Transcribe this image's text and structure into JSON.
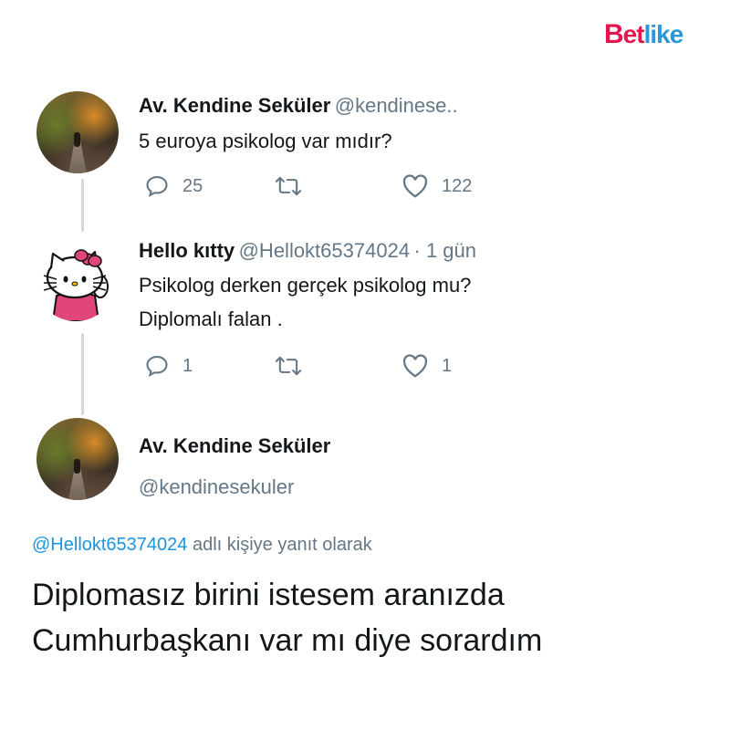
{
  "brand": {
    "logo_text_1": "B",
    "logo_text_2": "et",
    "logo_text_3": "like"
  },
  "tweets": [
    {
      "name": "Av. Kendine Seküler",
      "handle": "@kendinese..",
      "text": "5 euroya psikolog var mıdır?",
      "replies": "25",
      "likes": "122",
      "avatar_icon": "forest-path-avatar"
    },
    {
      "name": "Hello kıtty",
      "handle": "@Hellokt65374024",
      "time": "· 1 gün",
      "text_line1": "Psikolog derken gerçek psikolog mu?",
      "text_line2": "Diplomalı falan .",
      "replies": "1",
      "likes": "1",
      "avatar_icon": "hello-kitty-avatar"
    }
  ],
  "main_tweet": {
    "name": "Av. Kendine Seküler",
    "handle": "@kendinesekuler",
    "reply_mention": "@Hellokt65374024",
    "reply_suffix": "adlı kişiye yanıt olarak",
    "text_line1": "Diplomasız birini istesem aranızda",
    "text_line2": "Cumhurbaşkanı var mı diye sorardım",
    "avatar_icon": "forest-path-avatar"
  },
  "colors": {
    "brand_red": "#e2174e",
    "brand_blue": "#2a97d8",
    "mention_blue": "#1b95e0",
    "muted_gray": "#657786",
    "thread_line": "#cfd9de"
  }
}
